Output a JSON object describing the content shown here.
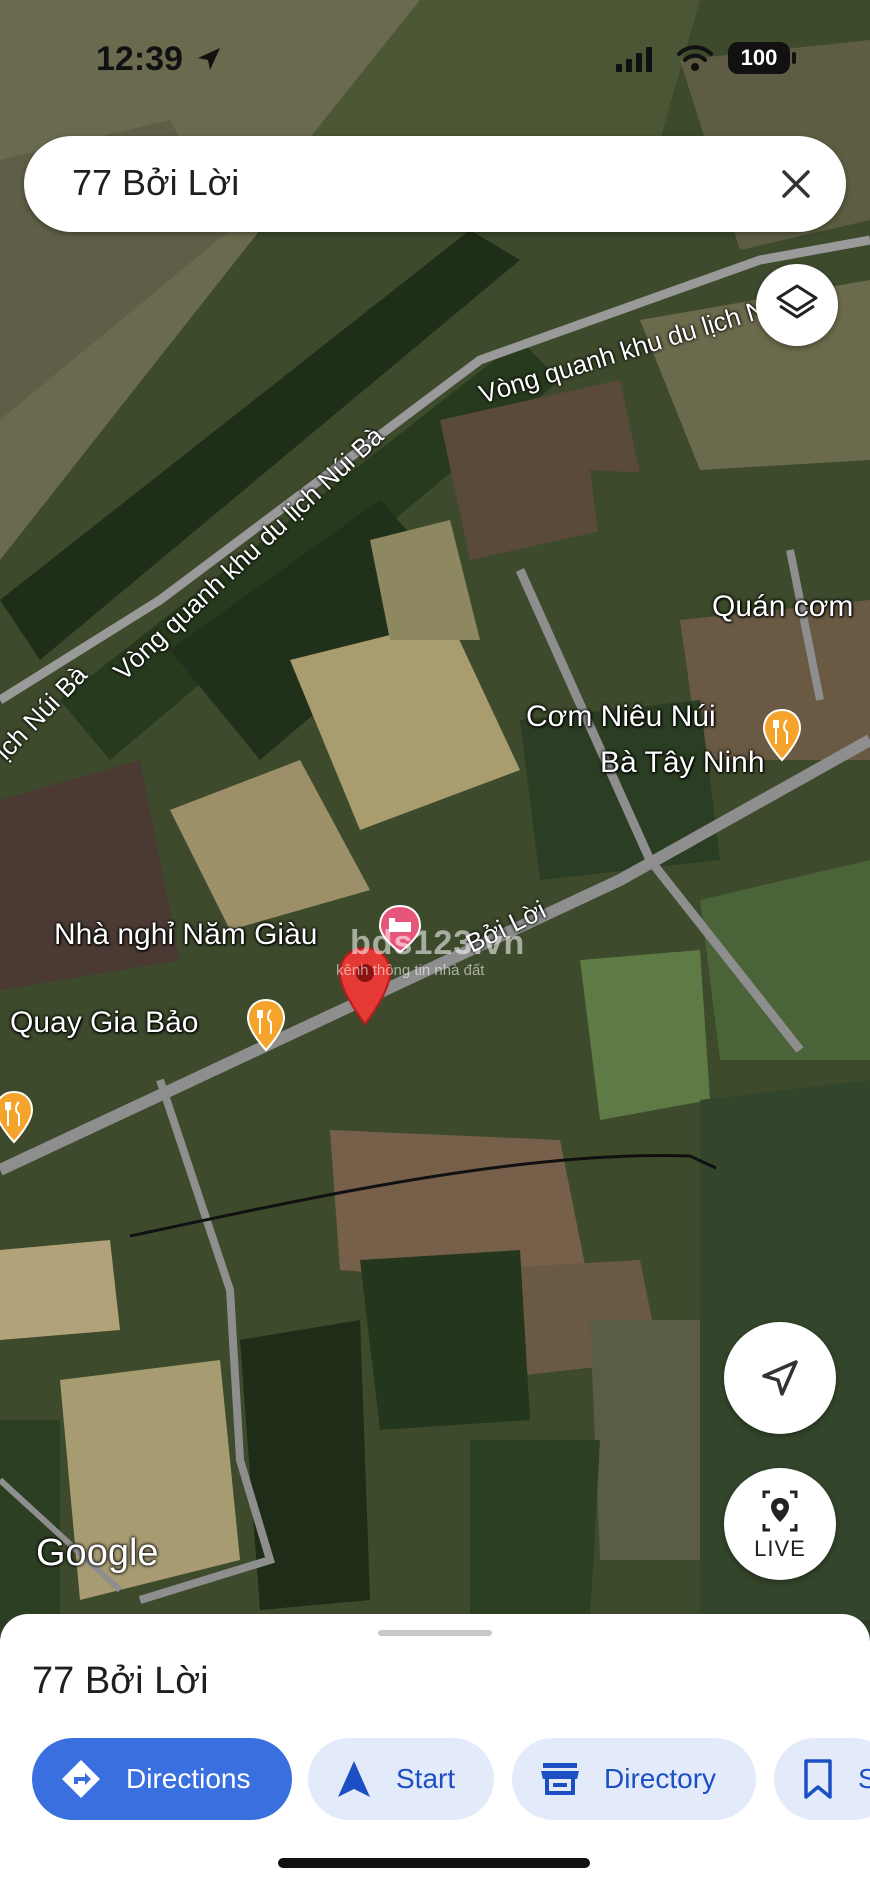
{
  "status_bar": {
    "time": "12:39",
    "battery": "100"
  },
  "search": {
    "query": "77 Bởi Lời"
  },
  "map": {
    "labels": {
      "quan_com": "Quán cơm",
      "com_nieu_line1": "Cơm Niêu Núi",
      "com_nieu_line2": "Bà Tây Ninh",
      "nha_nghi": "Nhà nghỉ Năm Giàu",
      "quay_gia_bao": "Quay Gia Bảo",
      "road_boi_loi": "Bởi Lời",
      "road_vong_quanh_1": "Vòng quanh khu du lịch Núi Bà",
      "road_vong_quanh_2": "Vòng quanh khu du lịch Núi Bà",
      "road_vong_quanh_3": "Vòng quanh khu du lịch Núi Bà",
      "road_fragment": "ịch Núi Bà"
    },
    "watermark": {
      "title": "bds123.vn",
      "subtitle": "kênh thông tin nhà đất"
    },
    "google_logo": "Google",
    "live_label": "LIVE"
  },
  "sheet": {
    "title": "77 Bởi Lời",
    "actions": {
      "directions": "Directions",
      "start": "Start",
      "directory": "Directory",
      "save": "S"
    }
  },
  "colors": {
    "primary_chip": "#3a6fe0",
    "secondary_chip": "#e3ebfb",
    "pin": "#e53935",
    "restaurant_pin": "#f4a42a"
  }
}
